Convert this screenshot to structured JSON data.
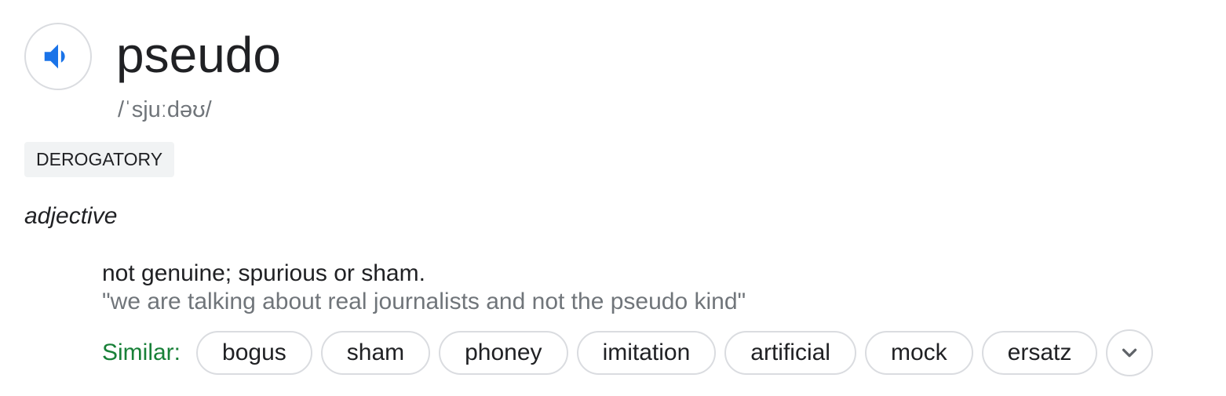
{
  "entry": {
    "word": "pseudo",
    "phonetic": "/ˈsjuːdəʊ/",
    "register_label": "DEROGATORY",
    "part_of_speech": "adjective",
    "definition": "not genuine; spurious or sham.",
    "example": "\"we are talking about real journalists and not the pseudo kind\""
  },
  "similar": {
    "label": "Similar:",
    "words": [
      "bogus",
      "sham",
      "phoney",
      "imitation",
      "artificial",
      "mock",
      "ersatz"
    ]
  },
  "icons": {
    "speaker": "volume-up-icon",
    "expand": "chevron-down-icon"
  },
  "colors": {
    "speaker_icon": "#1a73e8",
    "similar_label": "#188038",
    "secondary_text": "#70757a",
    "badge_bg": "#f1f3f4",
    "chip_border": "#dadce0"
  }
}
